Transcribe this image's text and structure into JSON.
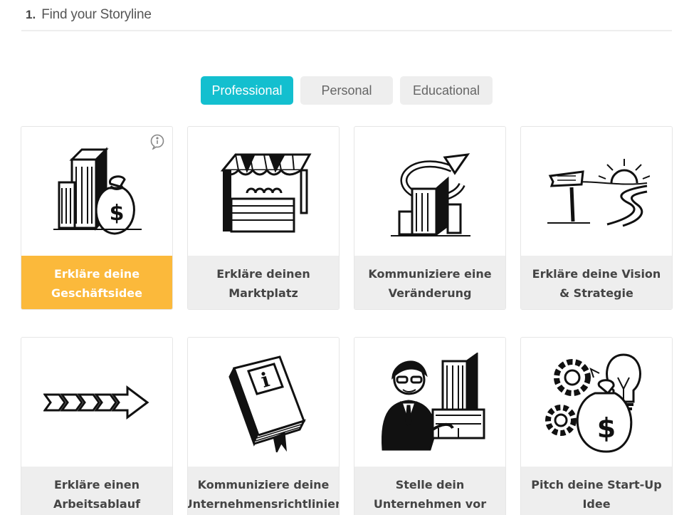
{
  "step": {
    "number": "1.",
    "title": "Find your Storyline"
  },
  "tabs": [
    {
      "label": "Professional",
      "active": true
    },
    {
      "label": "Personal",
      "active": false
    },
    {
      "label": "Educational",
      "active": false
    }
  ],
  "cards": [
    {
      "label": "Erkläre deine Geschäftsidee",
      "icon": "money-bag-buildings-icon",
      "selected": true
    },
    {
      "label": "Erkläre deinen Marktplatz",
      "icon": "market-stall-icon",
      "selected": false
    },
    {
      "label": "Kommuniziere eine Veränderung",
      "icon": "building-change-arrow-icon",
      "selected": false
    },
    {
      "label": "Erkläre deine Vision & Strategie",
      "icon": "signpost-sunrise-road-icon",
      "selected": false
    },
    {
      "label": "Erkläre einen Arbeitsablauf",
      "icon": "process-arrows-icon",
      "selected": false
    },
    {
      "label": "Kommuniziere deine Unternehmensrichtlinien",
      "icon": "info-book-icon",
      "selected": false
    },
    {
      "label": "Stelle dein Unternehmen vor",
      "icon": "businessman-building-icon",
      "selected": false
    },
    {
      "label": "Pitch deine Start-Up Idee",
      "icon": "gears-lightbulb-money-icon",
      "selected": false
    }
  ],
  "colors": {
    "accent": "#13bfcf",
    "selected": "#fbb93b",
    "tab_bg": "#eeeeee"
  }
}
